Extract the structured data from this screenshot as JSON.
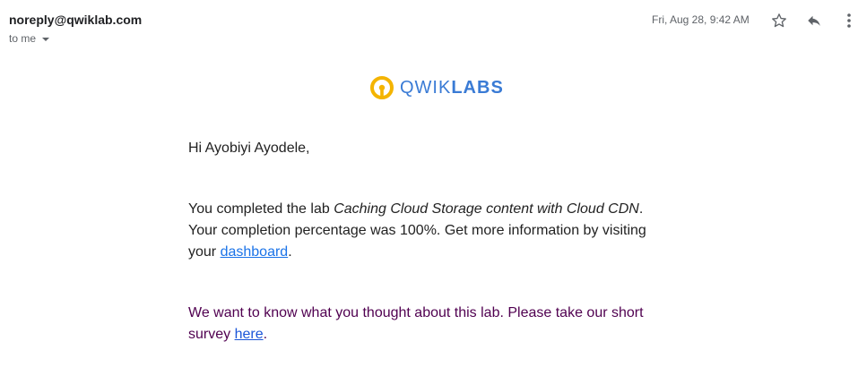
{
  "header": {
    "sender": "noreply@qwiklab.com",
    "recipient_label": "to me",
    "date": "Fri, Aug 28, 9:42 AM"
  },
  "icons": {
    "star": "star-icon",
    "reply": "reply-icon",
    "more": "more-vert-icon",
    "logo": "qwiklabs-logo-icon"
  },
  "logo": {
    "text_regular": "QWIK",
    "text_bold": "LABS",
    "ring_color": "#f4b400",
    "text_color": "#3a7bd5"
  },
  "email": {
    "greeting": "Hi Ayobiyi Ayodele,",
    "para1_prefix": "You completed the lab ",
    "lab_name": "Caching Cloud Storage content with Cloud CDN",
    "para1_suffix": ". Your completion percentage was 100%. Get more information by visiting your ",
    "dashboard_link": "dashboard",
    "para1_end": ".",
    "para2_prefix": "We want to know what you thought about this lab. Please take our short survey ",
    "survey_link": "here",
    "para2_end": "."
  }
}
